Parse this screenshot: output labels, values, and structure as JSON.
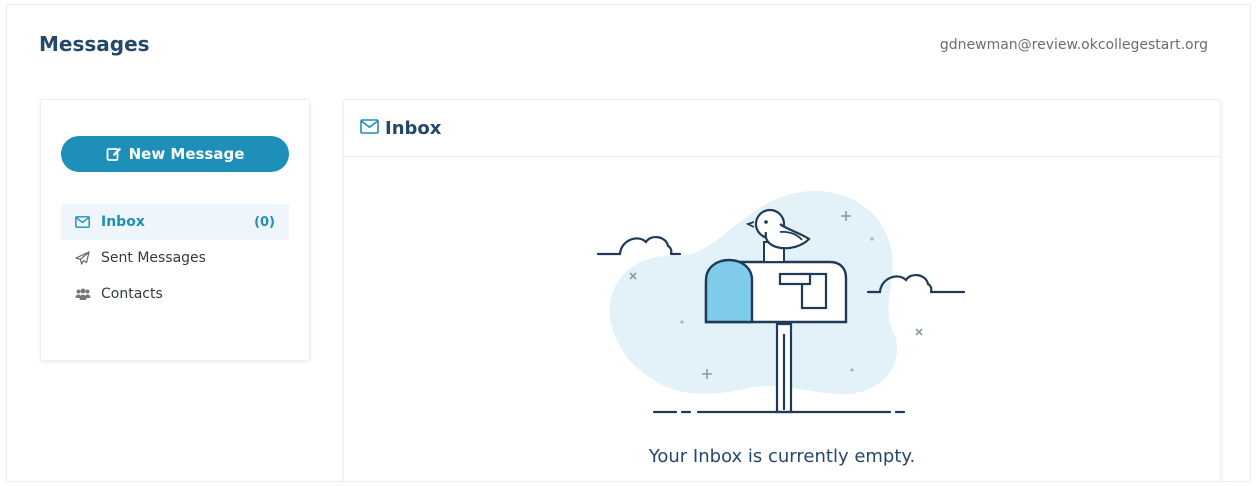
{
  "header": {
    "title": "Messages",
    "user_email": "gdnewman@review.okcollegestart.org"
  },
  "sidebar": {
    "new_message_label": "New Message",
    "items": [
      {
        "label": "Inbox",
        "count": "(0)",
        "icon": "envelope-icon",
        "active": true
      },
      {
        "label": "Sent Messages",
        "icon": "paper-plane-icon"
      },
      {
        "label": "Contacts",
        "icon": "users-icon"
      }
    ]
  },
  "inbox": {
    "title": "Inbox",
    "empty_message": "Your Inbox is currently empty."
  },
  "colors": {
    "accent": "#1d8fb8",
    "title": "#24486b",
    "illustration_blob": "#e3f2f9",
    "mailbox_door": "#7fcbea"
  }
}
